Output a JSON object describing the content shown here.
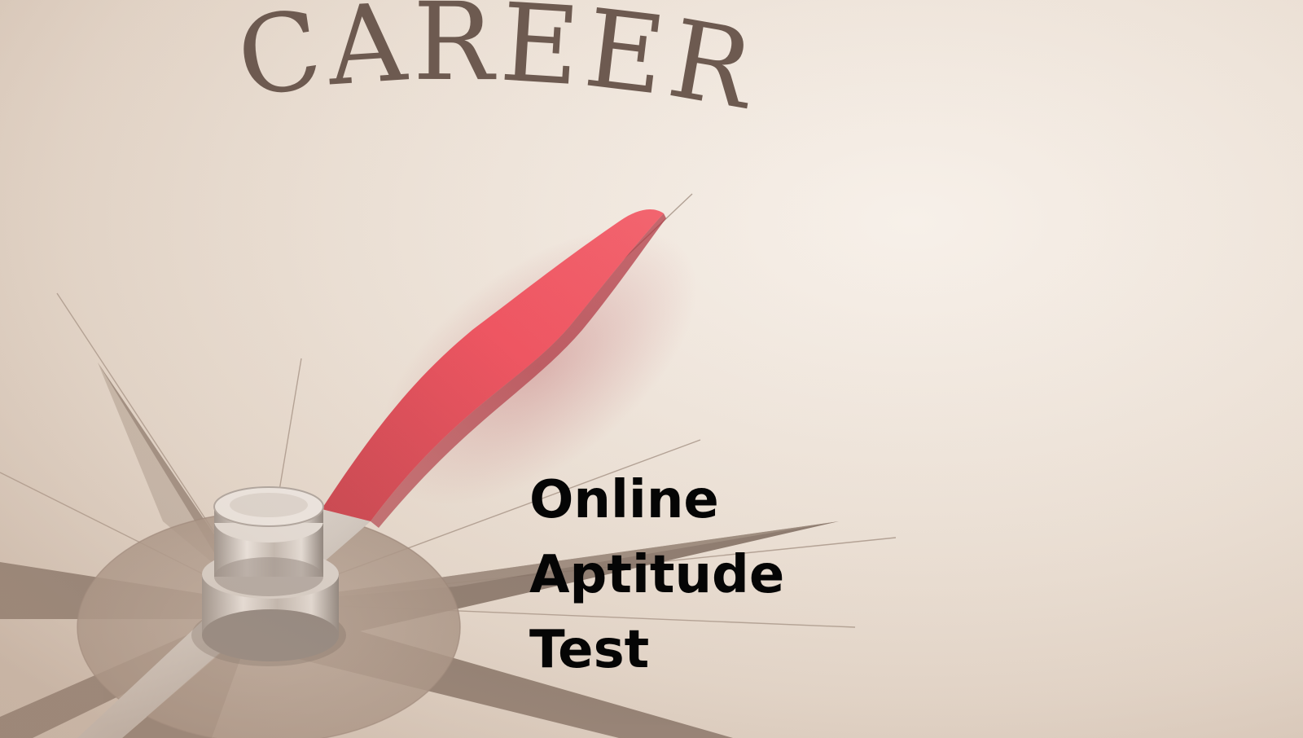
{
  "photo": {
    "headline_word": "CAREER",
    "caption_line1": "Online Aptitude",
    "caption_line2": "Test",
    "colors": {
      "background": "#ece1d6",
      "engraving": "#6d5a50",
      "needle_red": "#e43a4a",
      "caption_text": "#050505"
    },
    "objects": [
      "compass-rose",
      "compass-needle",
      "needle-pivot-cap"
    ]
  }
}
